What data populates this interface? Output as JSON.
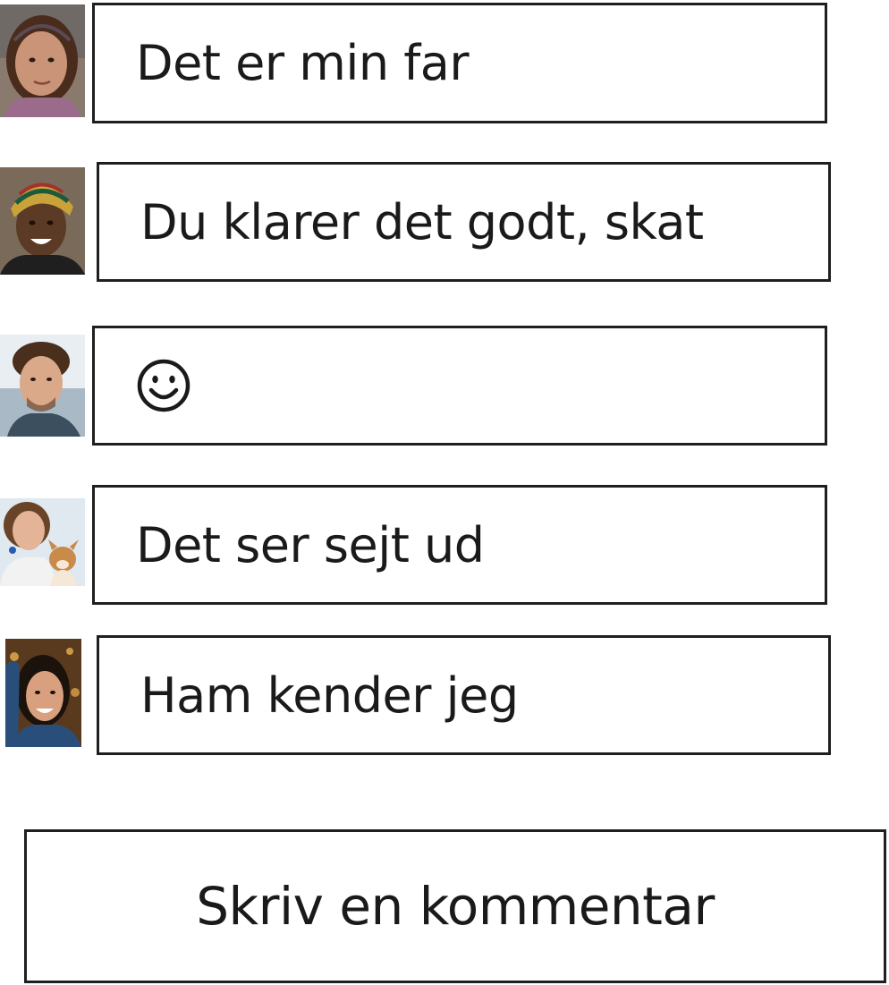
{
  "comments": [
    {
      "avatar_icon": "girl-avatar",
      "text": "Det er min far"
    },
    {
      "avatar_icon": "woman-headwrap-avatar",
      "text": "Du klarer det godt, skat"
    },
    {
      "avatar_icon": "young-man-avatar",
      "text": "",
      "icon": "smiley-icon"
    },
    {
      "avatar_icon": "woman-with-dog-avatar",
      "text": "Det ser sejt ud"
    },
    {
      "avatar_icon": "smiling-woman-avatar",
      "text": "Ham kender jeg"
    }
  ],
  "composer": {
    "placeholder": "Skriv en kommentar"
  }
}
